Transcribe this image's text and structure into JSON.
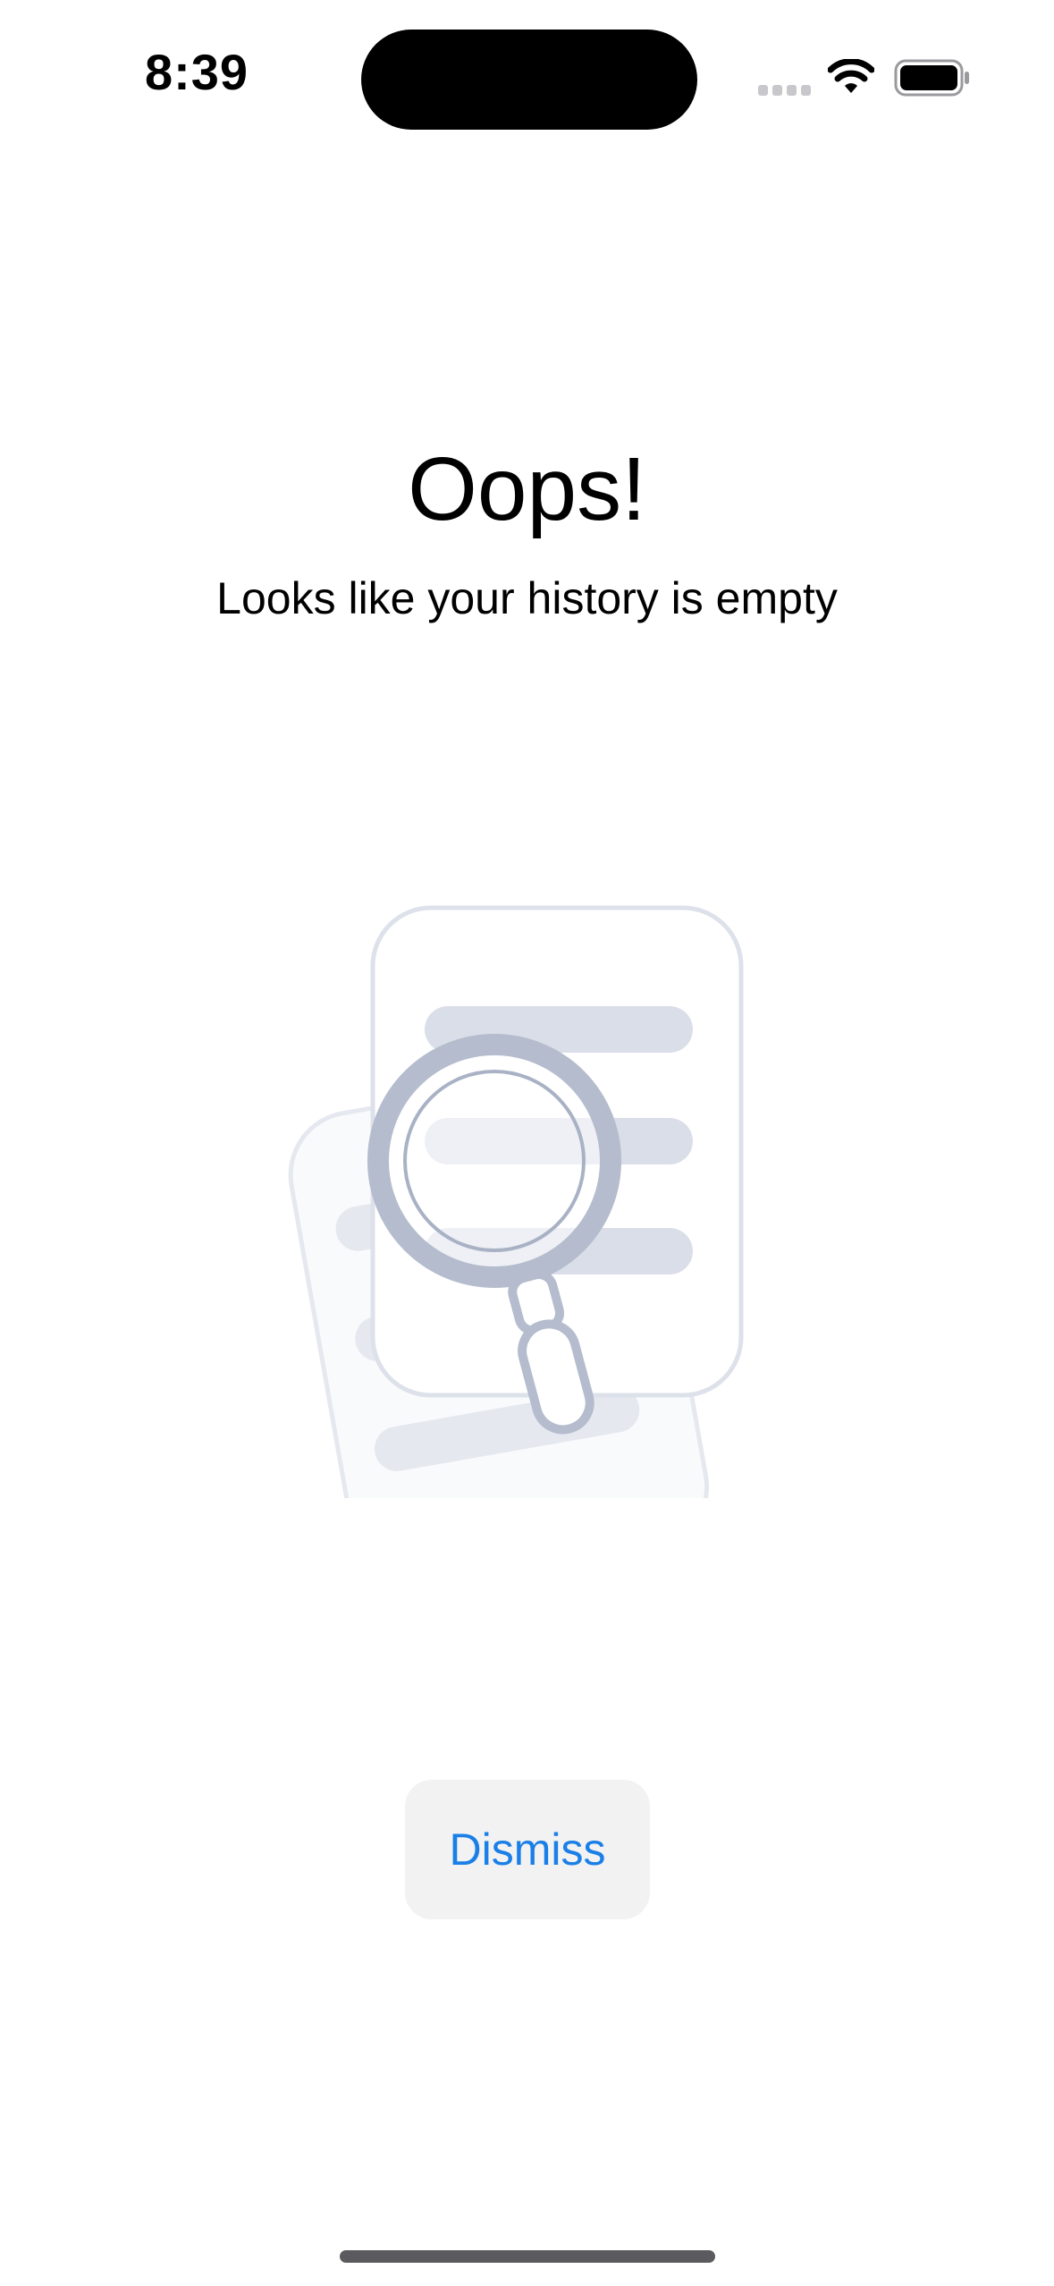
{
  "status_bar": {
    "time": "8:39",
    "icons": [
      "signal-icon",
      "wifi-icon",
      "battery-icon"
    ]
  },
  "empty_state": {
    "title": "Oops!",
    "message": "Looks like your history is empty",
    "illustration": "document-search-icon"
  },
  "actions": {
    "dismiss_label": "Dismiss"
  },
  "colors": {
    "accent": "#1a7fe6",
    "button_bg": "#f2f2f3",
    "illustration_stroke": "#b4bccd",
    "illustration_fill": "#d9dee8"
  }
}
